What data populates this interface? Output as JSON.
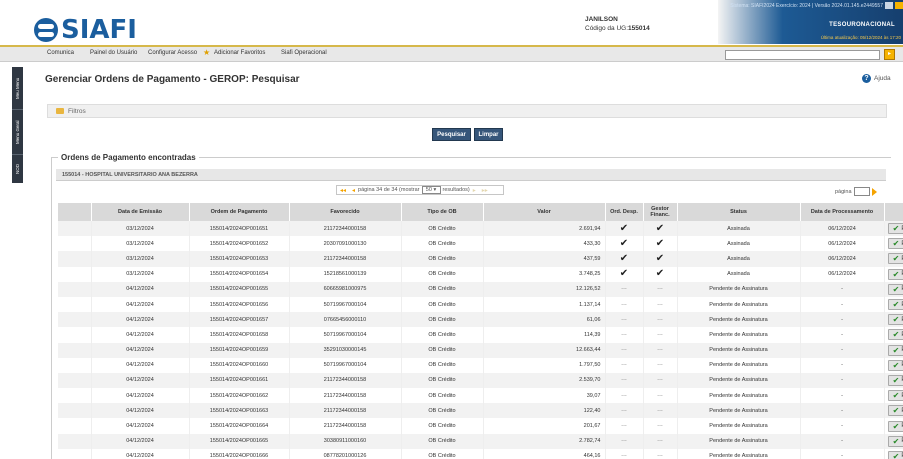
{
  "header": {
    "logo_text": "SIAFI",
    "user_name": "JANILSON",
    "ug_label": "Código da UG:",
    "ug_code": "155014",
    "system_info": "Sistema: SIAFI2024 Exercício: 2024 | Versão 2024.01.145.e2449557",
    "tesouro": "TESOURONACIONAL",
    "last_update": "Última atualização: 05/12/2024 às 17:20"
  },
  "menu": {
    "items": [
      "Comunica",
      "Painel do Usuário",
      "Configurar Acesso",
      "Adicionar Favoritos",
      "Siafi Operacional"
    ]
  },
  "sidebar": {
    "tabs": [
      "Meu Menu",
      "Menu Geral",
      "NOD"
    ]
  },
  "page": {
    "title": "Gerenciar Ordens de Pagamento - GEROP: Pesquisar",
    "help": "Ajuda",
    "filters": "Filtros",
    "btn_search": "Pesquisar",
    "btn_clear": "Limpar",
    "results_title": "Ordens de Pagamento encontradas",
    "ug_line": "155014 - HOSPITAL UNIVERSITARIO ANA BEZERRA"
  },
  "pager": {
    "prefix": "página 34 de 34 (mostrar",
    "per_page": "50",
    "suffix": "resultados)",
    "jump_label": "página"
  },
  "table": {
    "headers": [
      "",
      "Data de Emissão",
      "Ordem de Pagamento",
      "Favorecido",
      "Tipo de OB",
      "Valor",
      "Ord. Desp.",
      "Gestor Financ.",
      "Status",
      "Data de Processamento",
      ""
    ],
    "action_label": "Pré-Doc",
    "rows": [
      {
        "data": "03/12/2024",
        "op": "155014/2024OP001651",
        "fav": "21172344000158",
        "tipo": "OB Crédito",
        "valor": "2.691,94",
        "ord": "✔",
        "gest": "✔",
        "status": "Assinada",
        "proc": "06/12/2024"
      },
      {
        "data": "03/12/2024",
        "op": "155014/2024OP001652",
        "fav": "20307091000130",
        "tipo": "OB Crédito",
        "valor": "433,30",
        "ord": "✔",
        "gest": "✔",
        "status": "Assinada",
        "proc": "06/12/2024"
      },
      {
        "data": "03/12/2024",
        "op": "155014/2024OP001653",
        "fav": "21172344000158",
        "tipo": "OB Crédito",
        "valor": "437,59",
        "ord": "✔",
        "gest": "✔",
        "status": "Assinada",
        "proc": "06/12/2024"
      },
      {
        "data": "03/12/2024",
        "op": "155014/2024OP001654",
        "fav": "15218561000139",
        "tipo": "OB Crédito",
        "valor": "3.748,25",
        "ord": "✔",
        "gest": "✔",
        "status": "Assinada",
        "proc": "06/12/2024"
      },
      {
        "data": "04/12/2024",
        "op": "155014/2024OP001655",
        "fav": "60665981000975",
        "tipo": "OB Crédito",
        "valor": "12.126,52",
        "ord": "---",
        "gest": "---",
        "status": "Pendente de Assinatura",
        "proc": "-"
      },
      {
        "data": "04/12/2024",
        "op": "155014/2024OP001656",
        "fav": "50719967000104",
        "tipo": "OB Crédito",
        "valor": "1.137,14",
        "ord": "---",
        "gest": "---",
        "status": "Pendente de Assinatura",
        "proc": "-"
      },
      {
        "data": "04/12/2024",
        "op": "155014/2024OP001657",
        "fav": "07665456000110",
        "tipo": "OB Crédito",
        "valor": "61,06",
        "ord": "---",
        "gest": "---",
        "status": "Pendente de Assinatura",
        "proc": "-"
      },
      {
        "data": "04/12/2024",
        "op": "155014/2024OP001658",
        "fav": "50719967000104",
        "tipo": "OB Crédito",
        "valor": "114,39",
        "ord": "---",
        "gest": "---",
        "status": "Pendente de Assinatura",
        "proc": "-"
      },
      {
        "data": "04/12/2024",
        "op": "155014/2024OP001659",
        "fav": "35291030000145",
        "tipo": "OB Crédito",
        "valor": "12.663,44",
        "ord": "---",
        "gest": "---",
        "status": "Pendente de Assinatura",
        "proc": "-"
      },
      {
        "data": "04/12/2024",
        "op": "155014/2024OP001660",
        "fav": "50719967000104",
        "tipo": "OB Crédito",
        "valor": "1.797,50",
        "ord": "---",
        "gest": "---",
        "status": "Pendente de Assinatura",
        "proc": "-"
      },
      {
        "data": "04/12/2024",
        "op": "155014/2024OP001661",
        "fav": "21172344000158",
        "tipo": "OB Crédito",
        "valor": "2.539,70",
        "ord": "---",
        "gest": "---",
        "status": "Pendente de Assinatura",
        "proc": "-"
      },
      {
        "data": "04/12/2024",
        "op": "155014/2024OP001662",
        "fav": "21172344000158",
        "tipo": "OB Crédito",
        "valor": "39,07",
        "ord": "---",
        "gest": "---",
        "status": "Pendente de Assinatura",
        "proc": "-"
      },
      {
        "data": "04/12/2024",
        "op": "155014/2024OP001663",
        "fav": "21172344000158",
        "tipo": "OB Crédito",
        "valor": "122,40",
        "ord": "---",
        "gest": "---",
        "status": "Pendente de Assinatura",
        "proc": "-"
      },
      {
        "data": "04/12/2024",
        "op": "155014/2024OP001664",
        "fav": "21172344000158",
        "tipo": "OB Crédito",
        "valor": "201,67",
        "ord": "---",
        "gest": "---",
        "status": "Pendente de Assinatura",
        "proc": "-"
      },
      {
        "data": "04/12/2024",
        "op": "155014/2024OP001665",
        "fav": "30380911000160",
        "tipo": "OB Crédito",
        "valor": "2.782,74",
        "ord": "---",
        "gest": "---",
        "status": "Pendente de Assinatura",
        "proc": "-"
      },
      {
        "data": "04/12/2024",
        "op": "155014/2024OP001666",
        "fav": "08778201000126",
        "tipo": "OB Crédito",
        "valor": "464,16",
        "ord": "---",
        "gest": "---",
        "status": "Pendente de Assinatura",
        "proc": "-"
      }
    ]
  }
}
